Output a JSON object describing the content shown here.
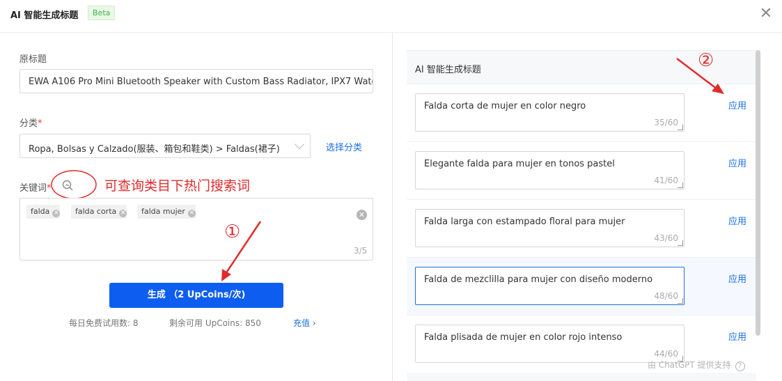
{
  "header": {
    "title": "AI 智能生成标题",
    "badge": "Beta",
    "close_icon": "close-icon"
  },
  "form": {
    "original_title_label": "原标题",
    "original_title_value": "EWA A106 Pro Mini Bluetooth Speaker with Custom Bass Radiator, IPX7 Wate",
    "category_label": "分类",
    "required_mark": "*",
    "category_value": "Ropa, Bolsas y Calzado(服装、箱包和鞋类) > Faldas(裙子)",
    "choose_category_link": "选择分类",
    "keywords_label": "关键词",
    "keywords": [
      "falda",
      "falda corta",
      "falda mujer"
    ],
    "keyword_count": "3/5",
    "generate_button": "生成 （2 UpCoins/次)",
    "daily_free_label": "每日免费试用数: 8",
    "remaining_label": "剩余可用 UpCoins: 850",
    "recharge_link": "充值 ›"
  },
  "annotations": {
    "search_hint": "可查询类目下热门搜索词",
    "marker_1": "①",
    "marker_2": "②"
  },
  "results": {
    "panel_title": "AI 智能生成标题",
    "apply_label": "应用",
    "items": [
      {
        "text": "Falda corta de mujer en color negro",
        "count": "35/60"
      },
      {
        "text": "Elegante falda para mujer en tonos pastel",
        "count": "41/60"
      },
      {
        "text": "Falda larga con estampado floral para mujer",
        "count": "43/60"
      },
      {
        "text": "Falda de mezclilla para mujer con diseño moderno",
        "count": "48/60"
      },
      {
        "text": "Falda plisada de mujer en color rojo intenso",
        "count": "44/60"
      }
    ],
    "footer": "由 ChatGPT 提供支持"
  },
  "colors": {
    "primary": "#0d5ef0",
    "link": "#1a6fe0",
    "annotation": "#e12b2b",
    "beta_green": "#3db34a"
  }
}
